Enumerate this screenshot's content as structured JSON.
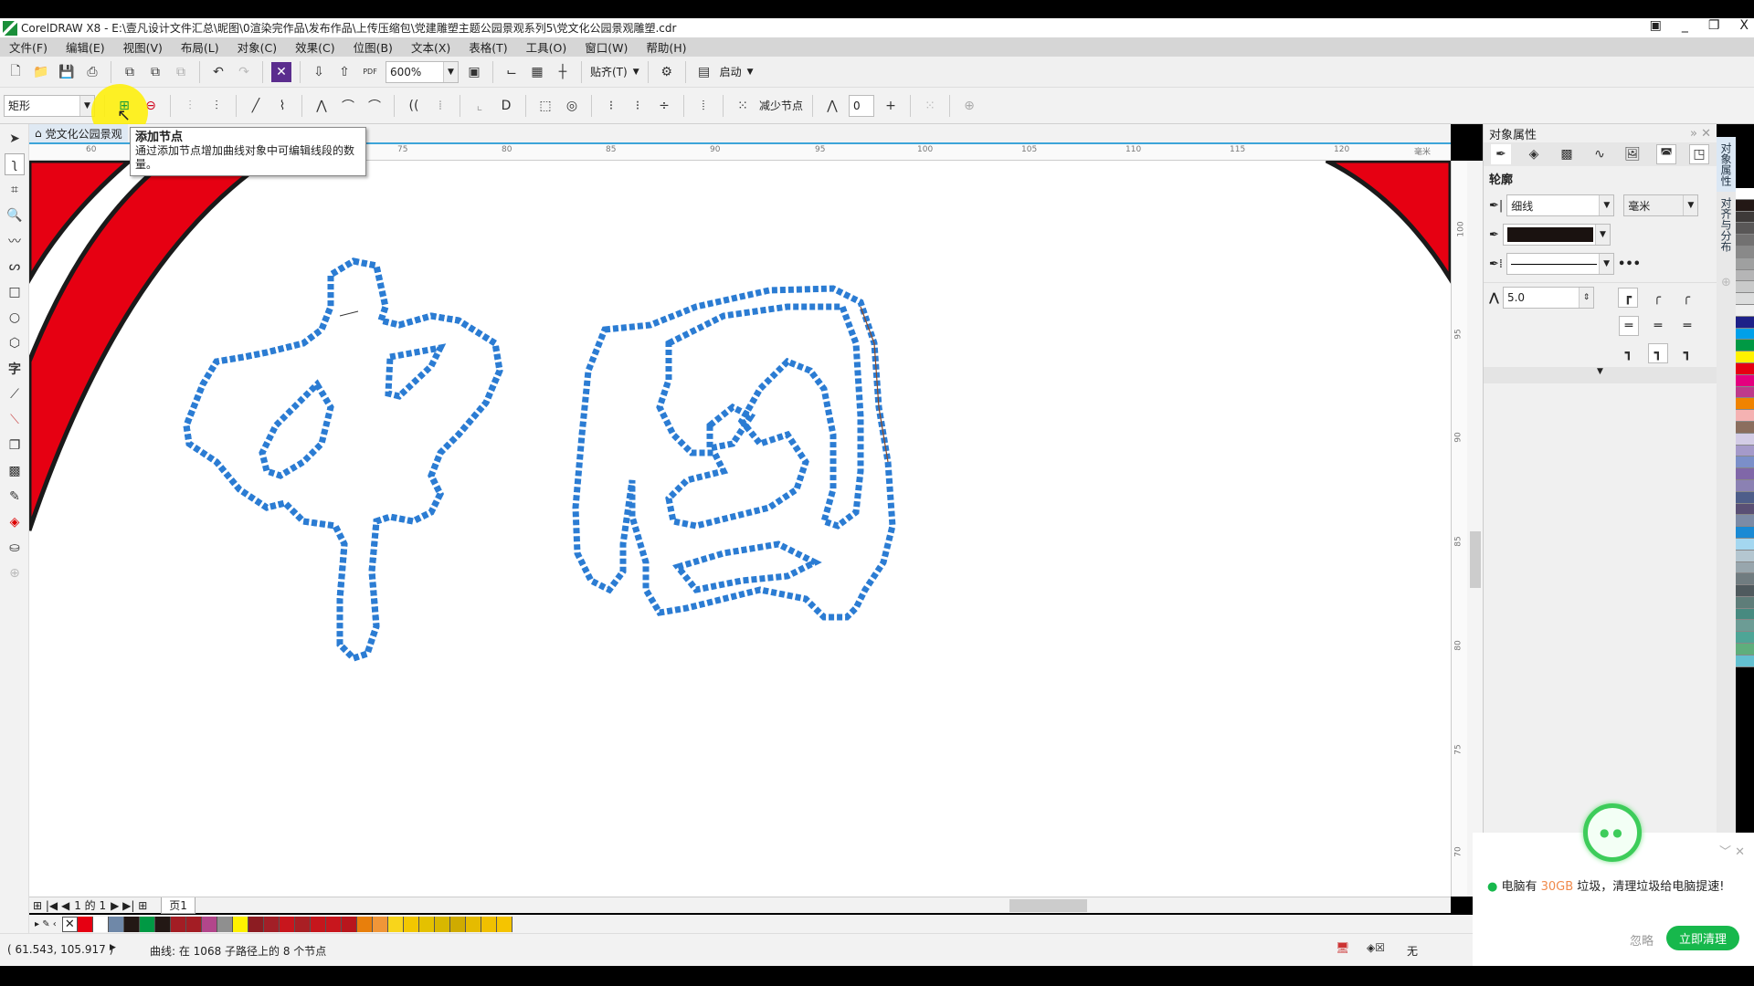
{
  "window": {
    "title": "CorelDRAW X8 - E:\\壹凡设计文件汇总\\昵图\\0渲染完作品\\发布作品\\上传压缩包\\党建雕塑主题公园景观系列5\\党文化公园景观雕塑.cdr",
    "controls": [
      "▣",
      "_",
      "❐",
      "X"
    ]
  },
  "menu": [
    "文件(F)",
    "编辑(E)",
    "视图(V)",
    "布局(L)",
    "对象(C)",
    "效果(C)",
    "位图(B)",
    "文本(X)",
    "表格(T)",
    "工具(O)",
    "窗口(W)",
    "帮助(H)"
  ],
  "toolbar": {
    "zoom": "600%",
    "snap": "贴齐(T)",
    "launch": "启动",
    "pdf": "PDF"
  },
  "propbar": {
    "object_type": "矩形",
    "reduce_nodes": "减少节点",
    "smoothness": "0"
  },
  "tooltip": {
    "title": "添加节点",
    "body": "通过添加节点增加曲线对象中可编辑线段的数量。"
  },
  "document": {
    "tab": "党文化公园景观",
    "unit": "毫米"
  },
  "ruler": {
    "h": [
      "60",
      "75",
      "80",
      "85",
      "90",
      "95",
      "100",
      "105",
      "110",
      "115",
      "120"
    ],
    "v": [
      "100",
      "95",
      "90",
      "85",
      "80",
      "75",
      "70"
    ]
  },
  "docker": {
    "title": "对象属性",
    "section": "轮廓",
    "width": "细线",
    "units": "毫米",
    "miter": "5.0",
    "outline_color": "#1a1210",
    "tabs": [
      "对象属性",
      "对齐与分布"
    ]
  },
  "pages": {
    "nav": "1 的 1",
    "tab": "页1"
  },
  "palette_v": [
    "#ffffff",
    "#231815",
    "#3e3a39",
    "#595757",
    "#727171",
    "#898989",
    "#9fa0a0",
    "#b5b5b6",
    "#c9caca",
    "#dcdddd",
    "#efefef",
    "#1d2088",
    "#00a0e9",
    "#009944",
    "#fff100",
    "#e60012",
    "#e4007f",
    "#be3a8b",
    "#f08300",
    "#f5b2b2",
    "#8b6e5e",
    "#d3cce6",
    "#a59aca",
    "#7b8fc9",
    "#8067a8",
    "#8b81b3",
    "#4e5e8a",
    "#5a5075",
    "#7c8ba6",
    "#1a8ad4",
    "#a4d7f0",
    "#b4c6d0",
    "#98a6ad",
    "#707c80",
    "#4f5a5e",
    "#5e7d79",
    "#478a80",
    "#6c9c95",
    "#4ea596",
    "#5fae7c",
    "#63c0d0"
  ],
  "palette_h": [
    "#e60012",
    "#ffffff",
    "#6f88a8",
    "#231815",
    "#009944",
    "#231815",
    "#a31d24",
    "#a31d24",
    "#b2468b",
    "#8f8f8f",
    "#fff100",
    "#8c1c22",
    "#a21f27",
    "#c8161d",
    "#a91f24",
    "#c5161c",
    "#c8161d",
    "#b8161d",
    "#e87f0c",
    "#f09638",
    "#f8d51b",
    "#f2c700",
    "#e4c100",
    "#d8b700",
    "#cfab00",
    "#e5bb00",
    "#f0c000",
    "#f5c400"
  ],
  "status": {
    "coords": "( 61.543, 105.917 )",
    "message": "曲线: 在 1068 子路径上的 8 个节点",
    "fill": "无"
  },
  "notification": {
    "prefix": "电脑有 ",
    "highlight": "30GB",
    "suffix": " 垃圾，清理垃圾给电脑提速!",
    "ignore": "忽略",
    "action": "立即清理",
    "accent": "#17b84c"
  },
  "colors": {
    "red": "#e60012",
    "node_blue": "#2b7cd3"
  }
}
